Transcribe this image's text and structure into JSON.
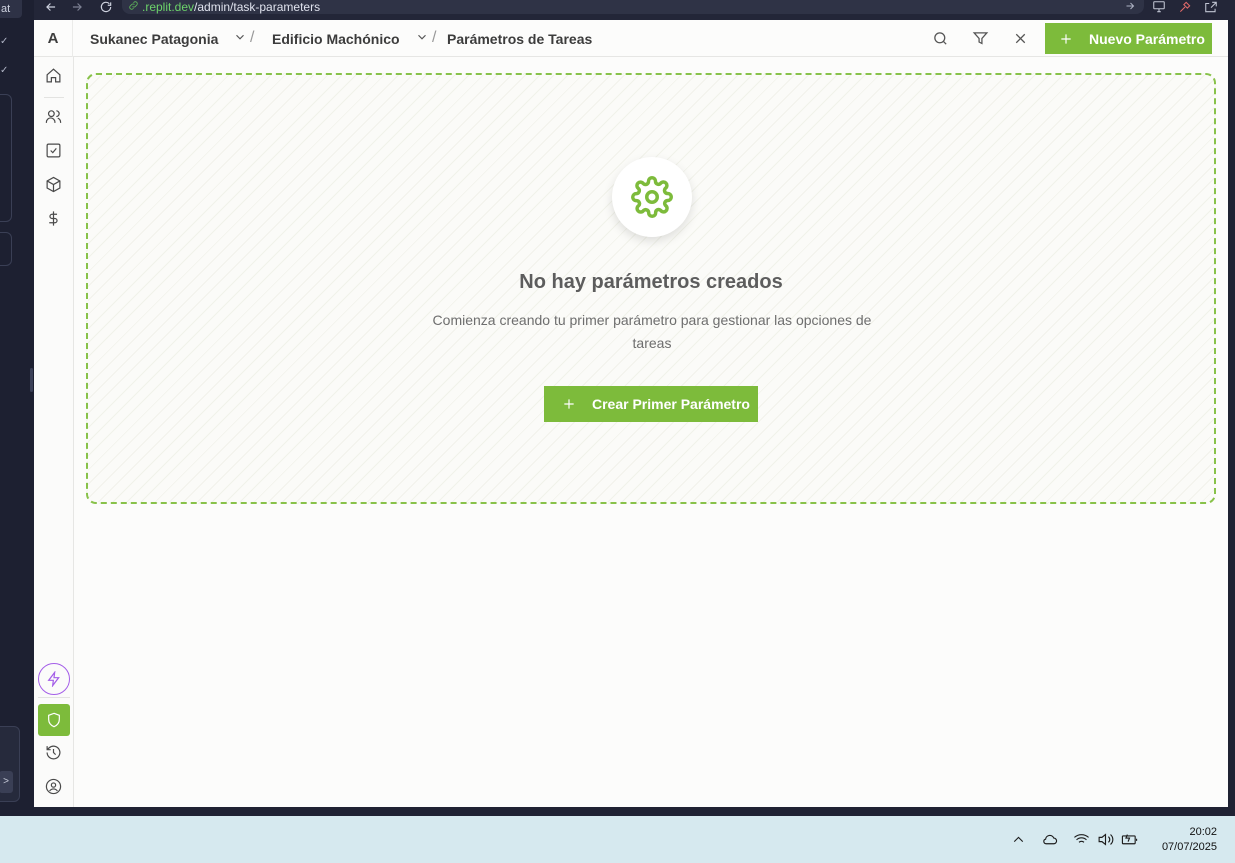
{
  "browser": {
    "url_host": ".replit.dev",
    "url_path": "/admin/task-parameters"
  },
  "outer_app": {
    "chip_label": "at",
    "tag_label": ">"
  },
  "header": {
    "logo": "A",
    "breadcrumb": [
      {
        "label": "Sukanec Patagonia",
        "has_dropdown": true
      },
      {
        "label": "Edificio Machónico",
        "has_dropdown": true
      },
      {
        "label": "Parámetros de Tareas",
        "has_dropdown": false
      }
    ],
    "separator": "/",
    "new_button_label": "Nuevo Parámetro",
    "icons": [
      "search-icon",
      "filter-icon",
      "close-icon"
    ]
  },
  "sidebar": {
    "items": [
      "home-icon",
      "users-icon",
      "tasks-icon",
      "box-icon",
      "dollar-icon"
    ],
    "bottom": [
      "bolt-icon",
      "shield-icon",
      "history-icon",
      "user-icon"
    ]
  },
  "empty_state": {
    "icon": "gear-icon",
    "title": "No hay parámetros creados",
    "description": "Comienza creando tu primer parámetro para gestionar las opciones de tareas",
    "button_label": "Crear Primer Parámetro"
  },
  "colors": {
    "accent": "#7dbb3b",
    "bolt": "#a45ee8"
  },
  "taskbar": {
    "time": "20:02",
    "date": "07/07/2025"
  }
}
